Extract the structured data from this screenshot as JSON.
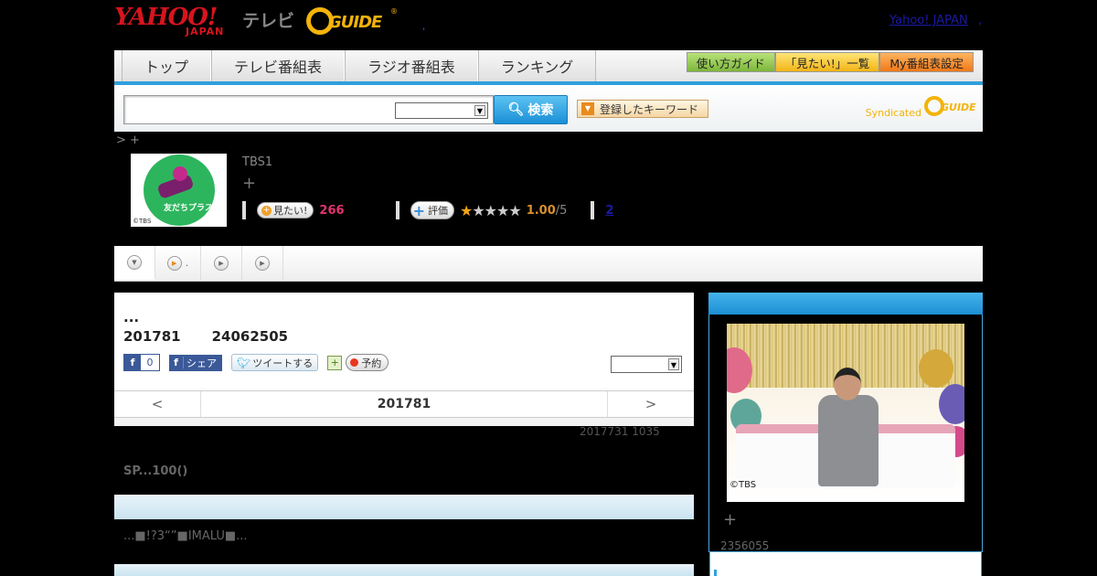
{
  "header": {
    "logo_yahoo": "YAHOO!",
    "logo_japan": "JAPAN",
    "logo_tv": "テレビ",
    "logo_gguide": "GUIDE",
    "logo_reg": "®",
    "small_comma": ",",
    "yahoo_japan_link": "Yahoo! JAPAN",
    "link_sep": ","
  },
  "nav": {
    "tabs": [
      "トップ",
      "テレビ番組表",
      "ラジオ番組表",
      "ランキング"
    ],
    "buttons": [
      {
        "label": "使い方ガイド",
        "color": "#8cc63f"
      },
      {
        "label": "「見たい!」一覧",
        "color": "#f8c51c"
      },
      {
        "label": "My番組表設定",
        "color": "#f7931e"
      }
    ],
    "accent": "#2ea0dc"
  },
  "search": {
    "input_value": "",
    "select_value": "",
    "button_label": "検索",
    "keyword_button": "登録したキーワード",
    "syndicated": "Syndicated",
    "syndicated_logo": "GUIDE"
  },
  "breadcrumb": "> +",
  "program": {
    "thumb_text": "友だちプラス",
    "thumb_copyright": "©TBS",
    "channel": "TBS1",
    "plus": "+",
    "mitai_label": "見たい!",
    "mitai_count": "266",
    "hyoka_label": "評価",
    "rating_stars": 1,
    "rating_value": "1.00",
    "rating_max": "/5",
    "review_count": "2"
  },
  "tabstrip": {
    "tabs": [
      {
        "icon": "down-arrow",
        "text": ""
      },
      {
        "icon": "play",
        "text": "."
      },
      {
        "icon": "play",
        "text": ""
      },
      {
        "icon": "play",
        "text": ""
      }
    ]
  },
  "main": {
    "ellipsis": "...",
    "date": "201781",
    "program_id": "24062505",
    "fb_like_count": "0",
    "fb_share": "シェア",
    "tweet": "ツイートする",
    "yoyaku": "予約",
    "select_value": "",
    "prev": "<",
    "current_date": "201781",
    "next": ">"
  },
  "updated": "2017731  1035",
  "sp_title": "SP...100()",
  "description": "...■!?3“”■IMALU■...",
  "side": {
    "photo_copyright": "©TBS",
    "plus": "+",
    "number": "2356055"
  }
}
